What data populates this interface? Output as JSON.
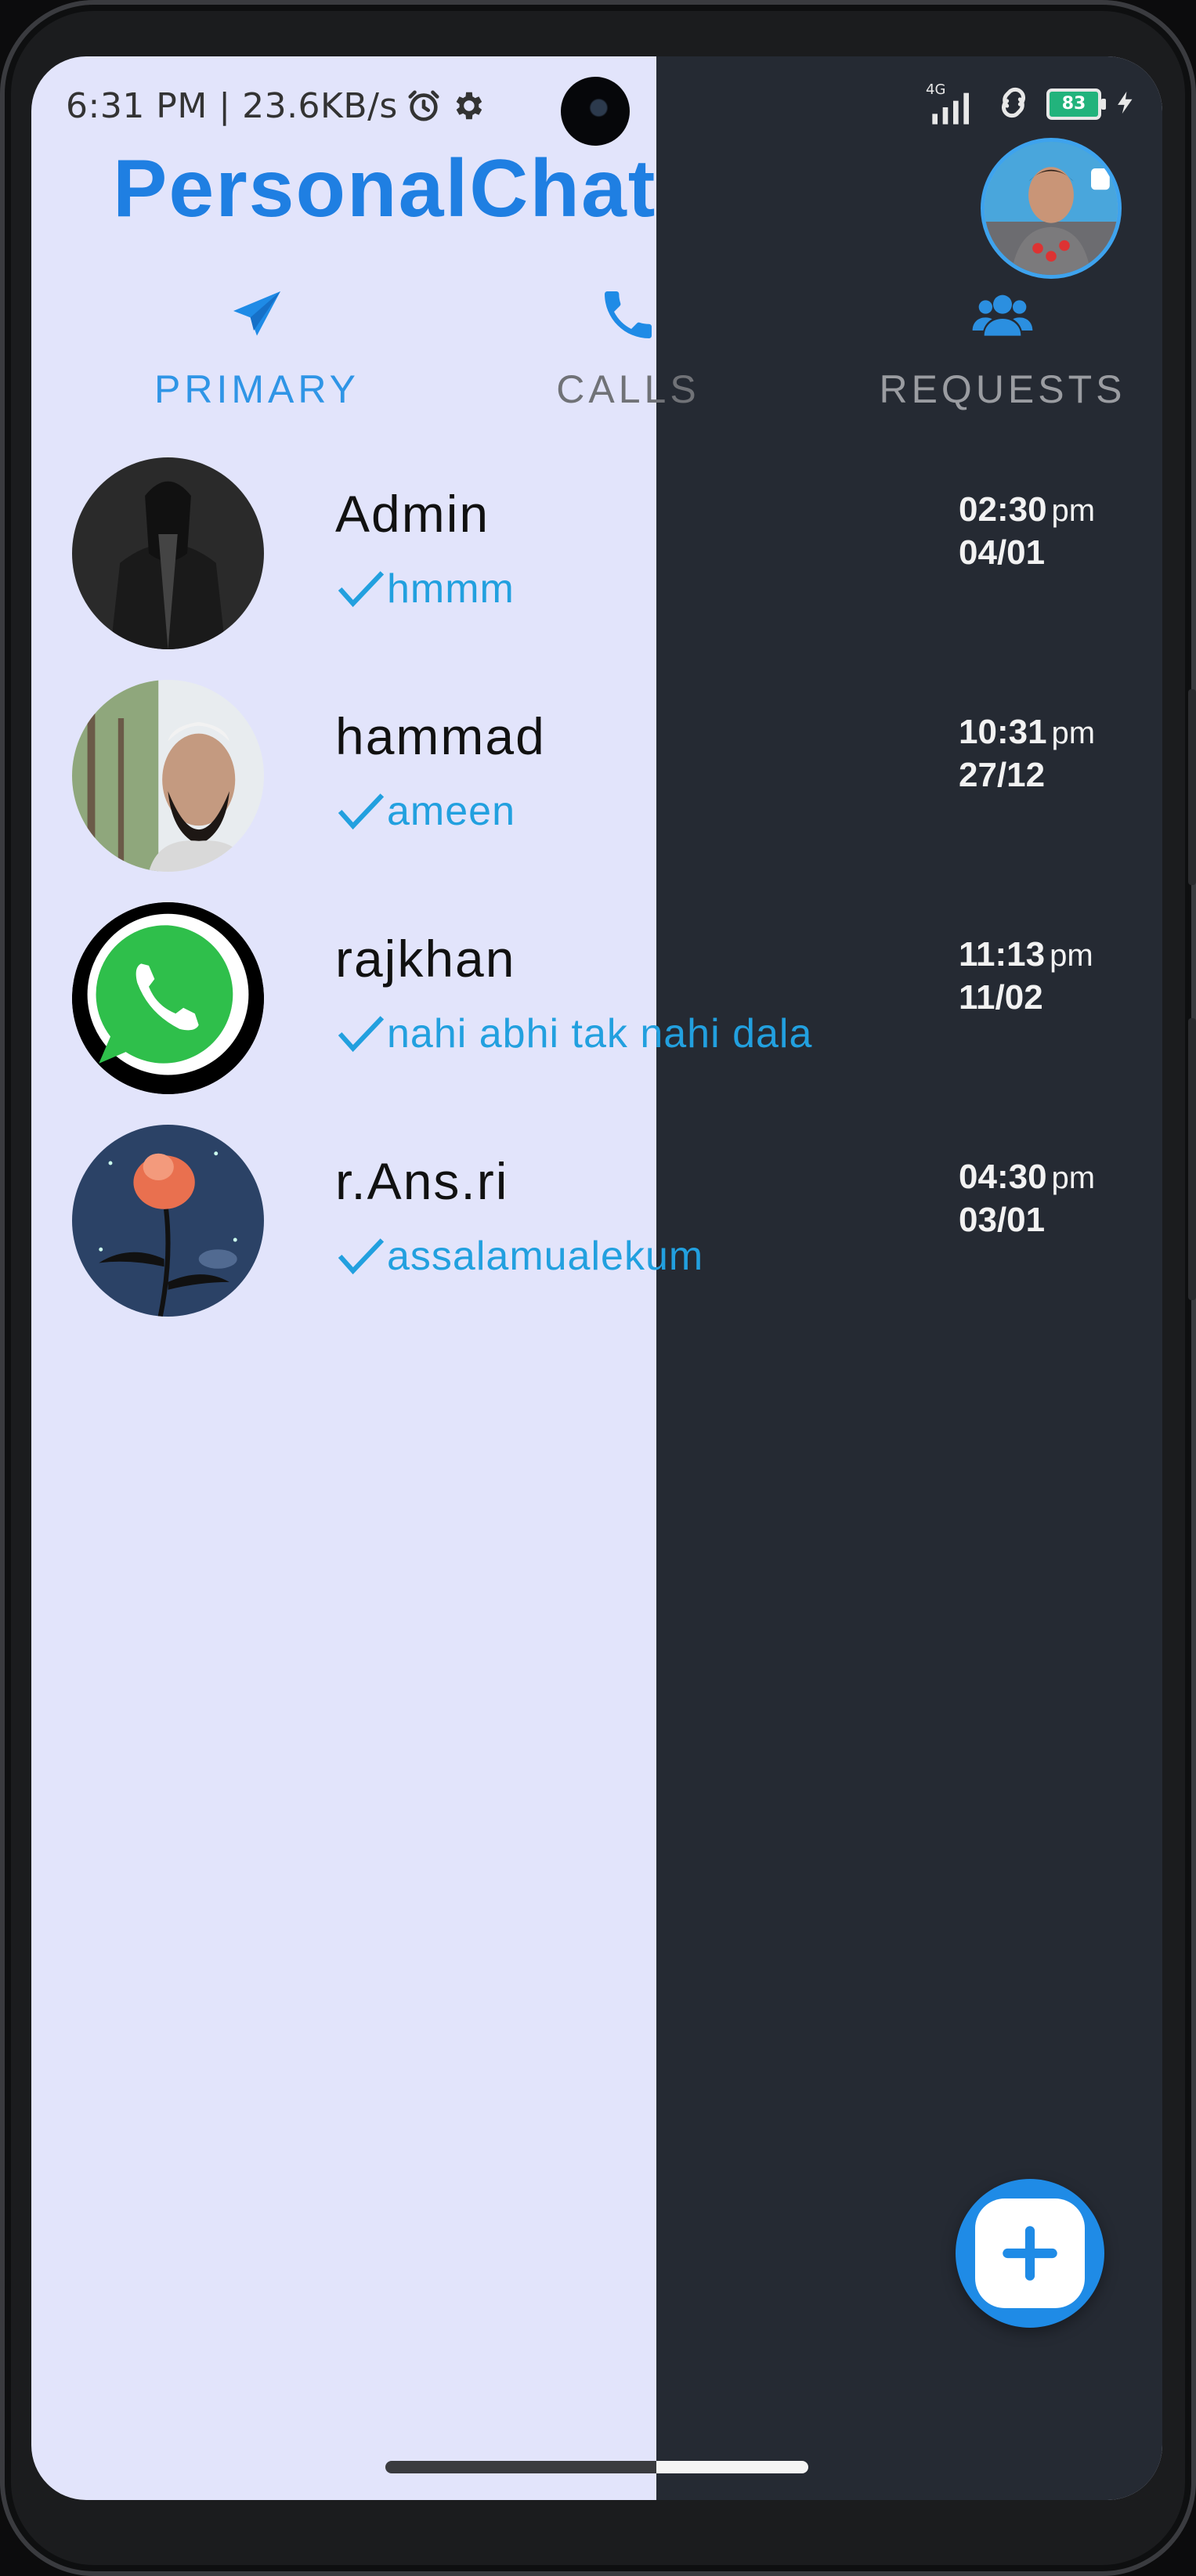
{
  "status_bar": {
    "time_speed": "6:31 PM | 23.6KB/s",
    "network": "4G",
    "battery": "83"
  },
  "header": {
    "title": "PersonalChat"
  },
  "tabs": [
    {
      "label": "PRIMARY",
      "icon": "paper-plane-icon",
      "selected": true
    },
    {
      "label": "CALLS",
      "icon": "phone-icon",
      "selected": false
    },
    {
      "label": "REQUESTS",
      "icon": "users-icon",
      "selected": false
    }
  ],
  "chats": [
    {
      "name": "Admin",
      "preview": "hmmm",
      "time": "02:30",
      "ampm": "pm",
      "date": "04/01"
    },
    {
      "name": "hammad",
      "preview": "ameen",
      "time": "10:31",
      "ampm": "pm",
      "date": "27/12"
    },
    {
      "name": "rajkhan",
      "preview": "nahi abhi tak nahi dala",
      "time": "11:13",
      "ampm": "pm",
      "date": "11/02"
    },
    {
      "name": "r.Ans.ri",
      "preview": "assalamualekum",
      "time": "04:30",
      "ampm": "pm",
      "date": "03/01"
    }
  ],
  "colors": {
    "accent": "#1f7fe2",
    "preview": "#22a0df",
    "light_bg": "#e2e4fb",
    "dark_bg": "#252a33"
  }
}
